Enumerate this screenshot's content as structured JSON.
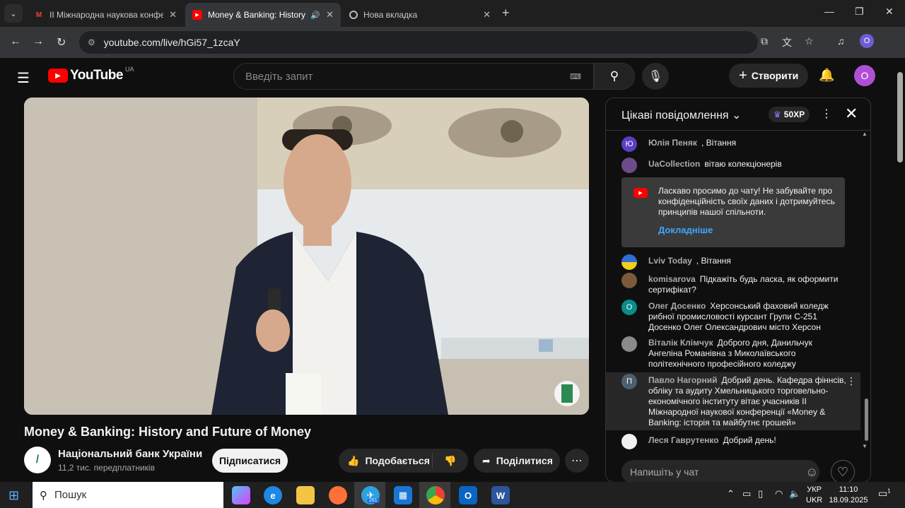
{
  "browser": {
    "tabs": [
      {
        "title": "ІІ Міжнародна наукова конфе",
        "favicon": "gmail-icon"
      },
      {
        "title": "Money & Banking: History a",
        "favicon": "youtube-icon"
      },
      {
        "title": "Нова вкладка",
        "favicon": "chrome-icon"
      }
    ],
    "url": "youtube.com/live/hGi57_1zcaY",
    "profile_initial": "O"
  },
  "youtube": {
    "logo_text": "YouTube",
    "country": "UA",
    "search_placeholder": "Введіть запит",
    "create_label": "Створити",
    "avatar_initial": "O"
  },
  "video": {
    "title": "Money & Banking: History and Future of Money",
    "channel_name": "Національний банк України",
    "subscribers": "11,2 тис. передплатників",
    "subscribe_label": "Підписатися",
    "like_label": "Подобається",
    "share_label": "Поділитися"
  },
  "chat": {
    "header": "Цікаві повідомлення",
    "xp": "50XP",
    "banner": {
      "text": "Ласкаво просимо до чату! Не забувайте про конфіденційність своїх даних і дотримуйтесь принципів нашої спільноти.",
      "link": "Докладніше"
    },
    "messages": [
      {
        "avatar": "Ю",
        "color": "#5b3fc2",
        "author": "Юлія Пеняк",
        "text": ", Вітання"
      },
      {
        "avatar": "",
        "color": "#6d4b88",
        "author": "UaCollection",
        "text": "вітаю колекціонерів"
      },
      {
        "avatar": "",
        "color": "#f2cf1a",
        "author": "Lviv Today",
        "text": ", Вітання"
      },
      {
        "avatar": "",
        "color": "#7a5a3a",
        "author": "komisarova",
        "text": "Підкажіть будь ласка, як оформити сертифікат?"
      },
      {
        "avatar": "О",
        "color": "#0a8c8c",
        "author": "Олег Досенко",
        "text": "Херсонський фаховий коледж рибної промисловості курсант Групи С-251 Досенко Олег Олександрович місто Херсон"
      },
      {
        "avatar": "",
        "color": "#8a8a8a",
        "author": "Віталік Клімчук",
        "text": "Доброго дня, Данильчук Ангеліна Романівна з Миколаївського політехнічного професійного коледжу"
      },
      {
        "avatar": "П",
        "color": "#4d6070",
        "author": "Павло Нагорний",
        "text": "Добрий день. Кафедра фіннсів, обліку та аудиту Хмельницького торговельно-економічного інституту вітає учасників ІІ Міжнародної наукової конференції «Money & Banking: історія та майбутнє грошей»"
      },
      {
        "avatar": "",
        "color": "#f1f1f1",
        "author": "Леся Гаврутенко",
        "text": "Добрий день!"
      }
    ],
    "input_placeholder": "Напишіть у чат"
  },
  "taskbar": {
    "search_label": "Пошук",
    "telegram_badge": "261",
    "lang_top": "УКР",
    "lang_bottom": "UKR",
    "time": "11:10",
    "date": "18.09.2025",
    "notifications": "1"
  }
}
